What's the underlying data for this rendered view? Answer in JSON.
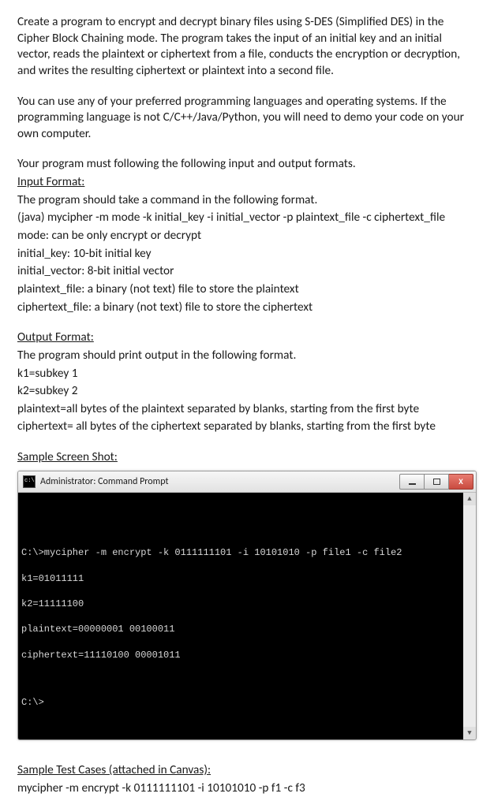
{
  "p1": "Create a program to encrypt and decrypt binary files using S-DES (Simplified DES) in the Cipher Block Chaining mode. The program takes the input of an initial key and an initial vector, reads the plaintext or ciphertext from a file, conducts the encryption or decryption, and writes the resulting ciphertext or plaintext into a second file.",
  "p2": "You can use any of your preferred programming languages and operating systems. If the programming language is not C/C++/Java/Python, you will need to demo your code on your own computer.",
  "p3": "Your program must following the following input and output formats.",
  "input_hdr": "Input Format:",
  "in1": "The program should take a command in the following format.",
  "in2": "(java) mycipher -m mode -k initial_key -i initial_vector -p plaintext_file -c ciphertext_file",
  "in3": "mode: can be only encrypt or decrypt",
  "in4": "initial_key: 10-bit initial key",
  "in5": "initial_vector: 8-bit initial vector",
  "in6": "plaintext_file: a binary (not text) file to store the plaintext",
  "in7": "ciphertext_file: a binary (not text) file to store the ciphertext",
  "output_hdr": "Output Format:",
  "out1": "The program should print output in the following format.",
  "out2": "k1=subkey 1",
  "out3": "k2=subkey 2",
  "out4": "plaintext=all bytes of the plaintext separated by blanks, starting from the first byte",
  "out5": "ciphertext= all bytes of the ciphertext separated by blanks, starting from the first byte",
  "sshot_hdr": "Sample Screen Shot:",
  "win_title": "Administrator: Command Prompt",
  "term_l1": "C:\\>mycipher -m encrypt -k 0111111101 -i 10101010 -p file1 -c file2",
  "term_l2": "k1=01011111",
  "term_l3": "k2=11111100",
  "term_l4": "plaintext=00000001 00100011",
  "term_l5": "ciphertext=11110100 00001011",
  "term_l6": "C:\\>",
  "tests_hdr": "Sample Test Cases (attached in Canvas):",
  "test1": "mycipher -m encrypt -k 0111111101 -i 10101010 -p f1 -c f3"
}
